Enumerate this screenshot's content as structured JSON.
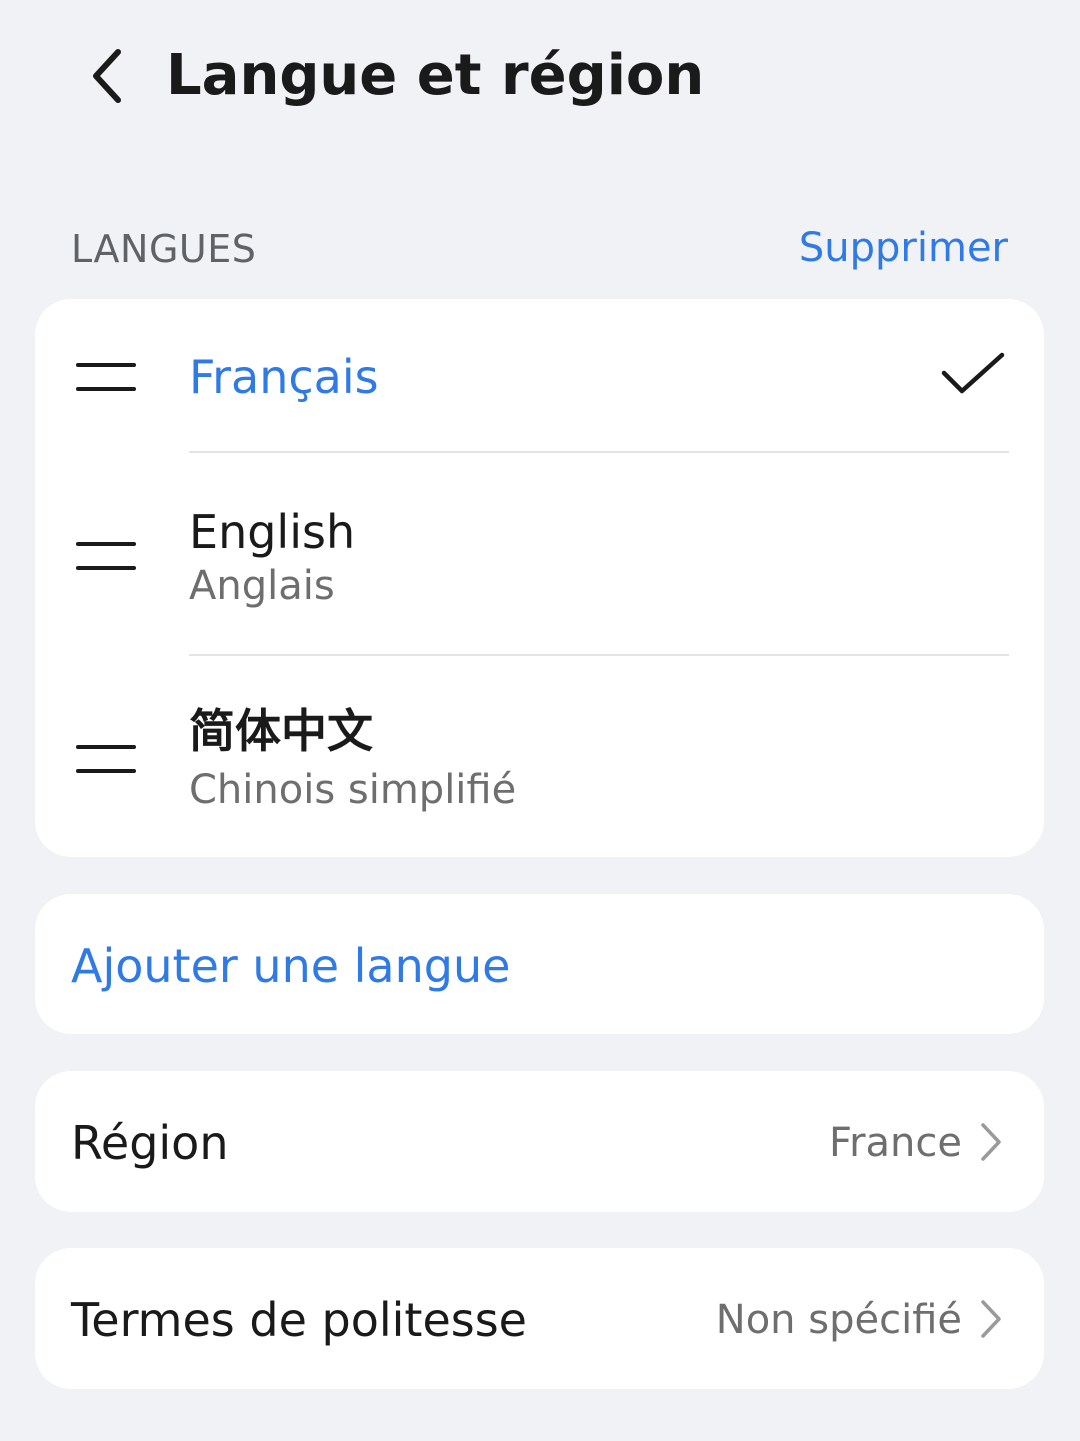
{
  "header": {
    "back_icon": "chevron-left-icon",
    "title": "Langue et région"
  },
  "languages_section": {
    "label": "LANGUES",
    "action_label": "Supprimer",
    "items": [
      {
        "name": "Français",
        "subtitle": "",
        "selected": true
      },
      {
        "name": "English",
        "subtitle": "Anglais",
        "selected": false
      },
      {
        "name": "简体中文",
        "subtitle": "Chinois simplifié",
        "selected": false
      }
    ],
    "selected_icon": "check-icon",
    "drag_icon": "drag-handle-icon"
  },
  "add_language": {
    "label": "Ajouter une langue"
  },
  "region": {
    "label": "Région",
    "value": "France",
    "icon": "chevron-right-icon"
  },
  "politeness": {
    "label": "Termes de politesse",
    "value": "Non spécifié",
    "icon": "chevron-right-icon"
  },
  "colors": {
    "accent": "#2f7ae5",
    "background": "#f1f2f6",
    "card": "#ffffff",
    "text_primary": "#1a1a1a",
    "text_secondary": "#6e6e6e"
  }
}
